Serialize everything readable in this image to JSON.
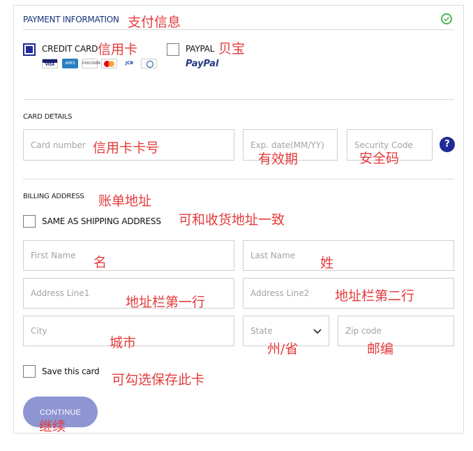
{
  "header": {
    "title": "PAYMENT INFORMATION",
    "title_note": "支付信息"
  },
  "payment_methods": {
    "credit_card": {
      "label": "CREDIT CARD",
      "note": "信用卡",
      "checked": true,
      "brands": [
        "VISA",
        "AMEX",
        "DISCOVER",
        "MasterCard",
        "JCB",
        "Diners Club"
      ]
    },
    "paypal": {
      "label": "PAYPAL",
      "note": "贝宝",
      "logo_text": "PayPal",
      "checked": false
    }
  },
  "card_details": {
    "title": "CARD DETAILS",
    "card_number": {
      "placeholder": "Card number",
      "note": "信用卡卡号"
    },
    "exp_date": {
      "placeholder": "Exp. date(MM/YY)",
      "note": "有效期"
    },
    "security_code": {
      "placeholder": "Security Code",
      "note": "安全码"
    },
    "help_label": "?"
  },
  "billing": {
    "title": "BILLING ADDRESS",
    "title_note": "账单地址",
    "same_as_shipping": {
      "label": "SAME AS SHIPPING ADDRESS",
      "note": "可和收货地址一致",
      "checked": false
    },
    "first_name": {
      "placeholder": "First Name",
      "note": "名"
    },
    "last_name": {
      "placeholder": "Last Name",
      "note": "姓"
    },
    "address1": {
      "placeholder": "Address Line1",
      "note": "地址栏第一行"
    },
    "address2": {
      "placeholder": "Address Line2",
      "note": "地址栏第二行"
    },
    "city": {
      "placeholder": "City",
      "note": "城市"
    },
    "state": {
      "placeholder": "State",
      "note": "州/省"
    },
    "zip": {
      "placeholder": "Zip code",
      "note": "邮编"
    }
  },
  "save_card": {
    "label": "Save this card",
    "note": "可勾选保存此卡",
    "checked": false
  },
  "continue_button": {
    "label": "CONTINUE",
    "note": "继续"
  },
  "colors": {
    "accent": "#1f2a96",
    "button": "#8e95d2",
    "annotation": "#e53b3b",
    "success": "#4fb454"
  }
}
